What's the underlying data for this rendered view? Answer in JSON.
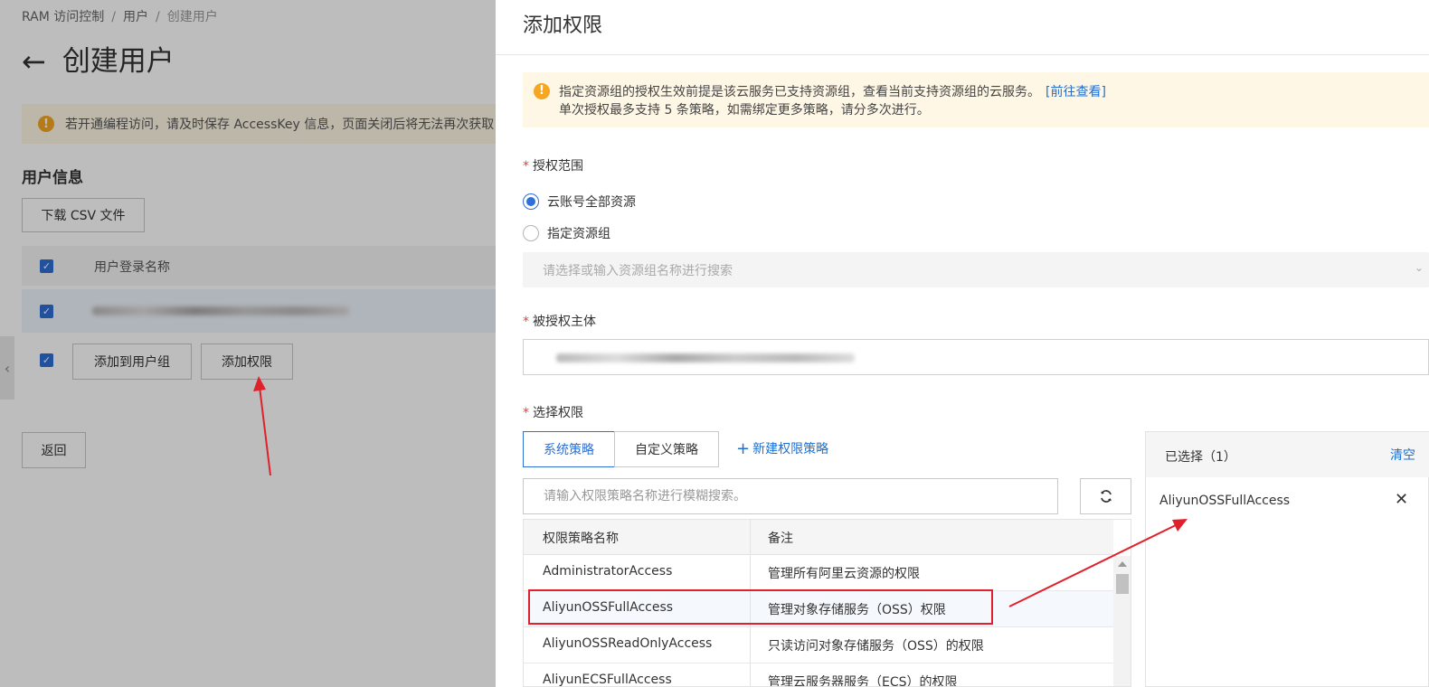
{
  "background": {
    "breadcrumb": [
      "RAM 访问控制",
      "用户",
      "创建用户"
    ],
    "breadcrumb_sep": "/",
    "page_title": "创建用户",
    "alert_text": "若开通编程访问，请及时保存 AccessKey 信息，页面关闭后将无法再次获取",
    "section_title": "用户信息",
    "download_csv": "下载 CSV 文件",
    "table_header": "用户登录名称",
    "add_to_group": "添加到用户组",
    "add_permission": "添加权限",
    "return": "返回"
  },
  "drawer": {
    "title": "添加权限",
    "notice_line1": "指定资源组的授权生效前提是该云服务已支持资源组，查看当前支持资源组的云服务。",
    "notice_link": "[前往查看]",
    "notice_line2": "单次授权最多支持 5 条策略，如需绑定更多策略，请分多次进行。",
    "scope_label": "授权范围",
    "scope_options": [
      "云账号全部资源",
      "指定资源组"
    ],
    "scope_selected": "云账号全部资源",
    "resource_group_placeholder": "请选择或输入资源组名称进行搜索",
    "principal_label": "被授权主体",
    "select_label": "选择权限",
    "tabs": [
      "系统策略",
      "自定义策略"
    ],
    "active_tab": "系统策略",
    "new_policy": "新建权限策略",
    "search_placeholder": "请输入权限策略名称进行模糊搜索。",
    "table_headers": [
      "权限策略名称",
      "备注"
    ],
    "policies": [
      {
        "name": "AdministratorAccess",
        "note": "管理所有阿里云资源的权限"
      },
      {
        "name": "AliyunOSSFullAccess",
        "note": "管理对象存储服务（OSS）权限"
      },
      {
        "name": "AliyunOSSReadOnlyAccess",
        "note": "只读访问对象存储服务（OSS）的权限"
      },
      {
        "name": "AliyunECSFullAccess",
        "note": "管理云服务器服务（ECS）的权限"
      }
    ],
    "selected_title": "已选择（1）",
    "clear": "清空",
    "selected_items": [
      "AliyunOSSFullAccess"
    ]
  },
  "colors": {
    "accent": "#2f6fd6",
    "link": "#1f6fd0",
    "warning": "#f5a623",
    "annotation": "#e0202a"
  }
}
